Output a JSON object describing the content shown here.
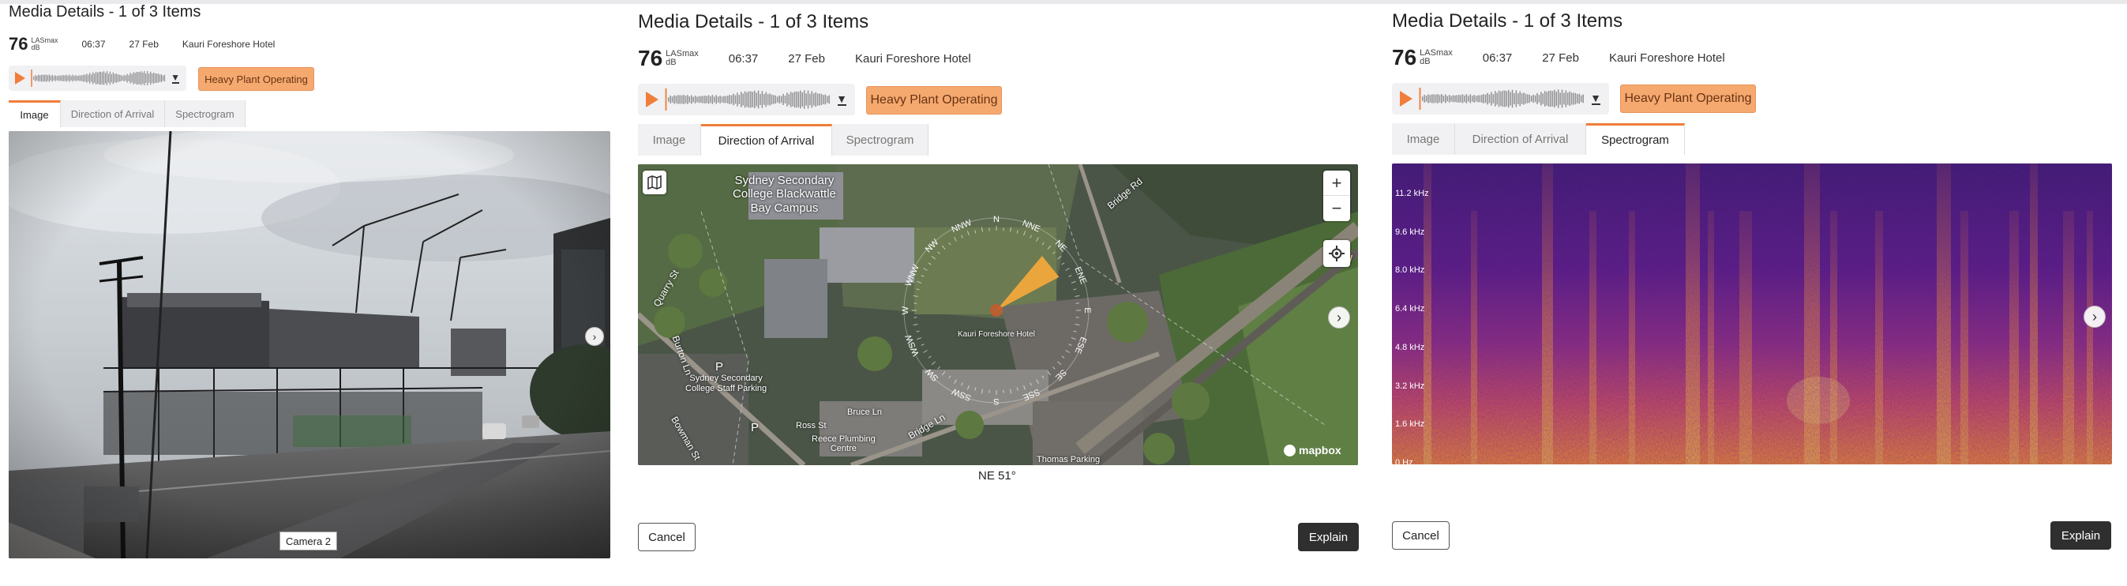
{
  "panels": [
    {
      "title": "Media Details - 1 of 3 Items",
      "level": "76",
      "unit_top": "LASmax",
      "unit_bottom": "dB",
      "time": "06:37",
      "date": "27 Feb",
      "location": "Kauri Foreshore Hotel",
      "tag": "Heavy Plant Operating",
      "tabs": [
        "Image",
        "Direction of Arrival",
        "Spectrogram"
      ],
      "active_tab": "Image",
      "camera_label": "Camera 2"
    },
    {
      "title": "Media Details - 1 of 3 Items",
      "level": "76",
      "unit_top": "LASmax",
      "unit_bottom": "dB",
      "time": "06:37",
      "date": "27 Feb",
      "location": "Kauri Foreshore Hotel",
      "tag": "Heavy Plant Operating",
      "tabs": [
        "Image",
        "Direction of Arrival",
        "Spectrogram"
      ],
      "active_tab": "Direction of Arrival",
      "map": {
        "labels": [
          "Sydney Secondary",
          "College Blackwattle",
          "Bay Campus",
          "Sydney Secondary",
          "College Staff Parking",
          "Bridge Rd",
          "Quarry St",
          "Burton Ln",
          "Bowman St",
          "Bridge Ln",
          "Reece Plumbing",
          "Centre",
          "Ross St",
          "Bruce Ln",
          "Thomas Parking",
          "Kauri Foreshore Hotel",
          "P",
          "P",
          "W"
        ],
        "compass": [
          "N",
          "NNE",
          "NE",
          "ENE",
          "E",
          "ESE",
          "SE",
          "SSE",
          "S",
          "SSW",
          "SW",
          "WSW",
          "W",
          "WNW",
          "NW",
          "NNW"
        ],
        "bearing_deg": 51,
        "zoom_in": "+",
        "zoom_out": "−",
        "attribution": "mapbox"
      },
      "readout": "NE 51°",
      "cancel_label": "Cancel",
      "explain_label": "Explain"
    },
    {
      "title": "Media Details - 1 of 3 Items",
      "level": "76",
      "unit_top": "LASmax",
      "unit_bottom": "dB",
      "time": "06:37",
      "date": "27 Feb",
      "location": "Kauri Foreshore Hotel",
      "tag": "Heavy Plant Operating",
      "tabs": [
        "Image",
        "Direction of Arrival",
        "Spectrogram"
      ],
      "active_tab": "Spectrogram",
      "freq_labels": [
        "11.2 kHz",
        "9.6 kHz",
        "8.0 kHz",
        "6.4 kHz",
        "4.8 kHz",
        "3.2 kHz",
        "1.6 kHz",
        "0 Hz"
      ],
      "cancel_label": "Cancel",
      "explain_label": "Explain"
    }
  ],
  "colors": {
    "accent": "#f07e3a",
    "tag_bg": "#f5a96f",
    "explain_bg": "#2f2f2f"
  }
}
